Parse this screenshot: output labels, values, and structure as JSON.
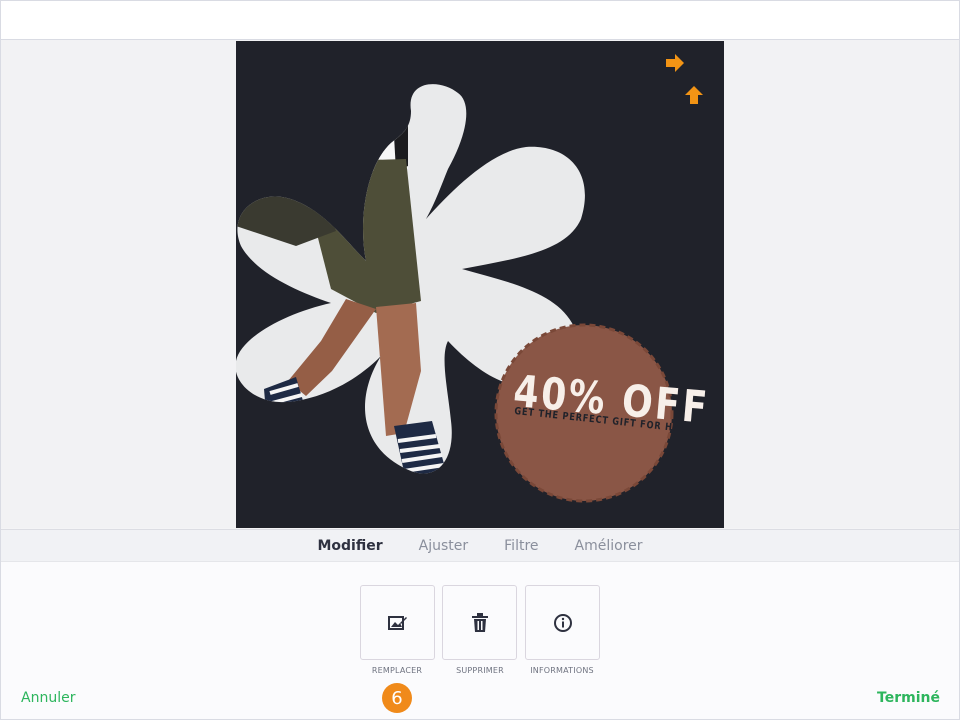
{
  "artwork": {
    "headline": "40% OFF",
    "tagline": "GET THE PERFECT GIFT FOR HIM",
    "colors": {
      "background": "#20222a",
      "flower": "#e9eaeb",
      "badge": "#8a5646",
      "text": "#f7efe9"
    },
    "markers": [
      {
        "icon": "arrow-right-icon",
        "color": "#f29415"
      },
      {
        "icon": "arrow-up-icon",
        "color": "#f29415"
      }
    ]
  },
  "tabs": [
    {
      "label": "Modifier",
      "active": true
    },
    {
      "label": "Ajuster",
      "active": false
    },
    {
      "label": "Filtre",
      "active": false
    },
    {
      "label": "Améliorer",
      "active": false
    }
  ],
  "tools": [
    {
      "label": "REMPLACER",
      "icon": "replace-image-icon"
    },
    {
      "label": "SUPPRIMER",
      "icon": "trash-icon"
    },
    {
      "label": "INFORMATIONS",
      "icon": "info-icon"
    }
  ],
  "footer": {
    "cancel_label": "Annuler",
    "done_label": "Terminé",
    "step_badge": "6",
    "accent_color": "#2db55d",
    "badge_color": "#f08a1a"
  }
}
